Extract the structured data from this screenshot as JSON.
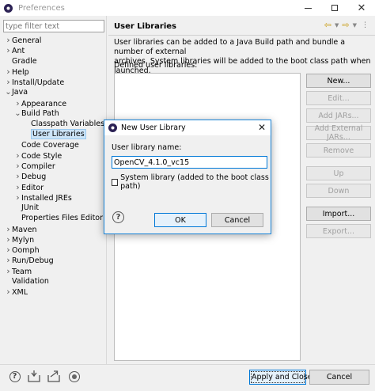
{
  "window": {
    "title": "Preferences",
    "icon": "eclipse-icon"
  },
  "filter": {
    "placeholder": "type filter text",
    "value": ""
  },
  "tree": [
    {
      "label": "General",
      "expander": "collapsed",
      "indent": 0
    },
    {
      "label": "Ant",
      "expander": "collapsed",
      "indent": 0
    },
    {
      "label": "Gradle",
      "expander": "none",
      "indent": 0
    },
    {
      "label": "Help",
      "expander": "collapsed",
      "indent": 0
    },
    {
      "label": "Install/Update",
      "expander": "collapsed",
      "indent": 0
    },
    {
      "label": "Java",
      "expander": "expanded",
      "indent": 0
    },
    {
      "label": "Appearance",
      "expander": "collapsed",
      "indent": 1
    },
    {
      "label": "Build Path",
      "expander": "expanded",
      "indent": 1
    },
    {
      "label": "Classpath Variables",
      "expander": "none",
      "indent": 2
    },
    {
      "label": "User Libraries",
      "expander": "none",
      "indent": 2,
      "selected": true
    },
    {
      "label": "Code Coverage",
      "expander": "none",
      "indent": 1
    },
    {
      "label": "Code Style",
      "expander": "collapsed",
      "indent": 1
    },
    {
      "label": "Compiler",
      "expander": "collapsed",
      "indent": 1
    },
    {
      "label": "Debug",
      "expander": "collapsed",
      "indent": 1
    },
    {
      "label": "Editor",
      "expander": "collapsed",
      "indent": 1
    },
    {
      "label": "Installed JREs",
      "expander": "collapsed",
      "indent": 1
    },
    {
      "label": "JUnit",
      "expander": "none",
      "indent": 1
    },
    {
      "label": "Properties Files Editor",
      "expander": "none",
      "indent": 1
    },
    {
      "label": "Maven",
      "expander": "collapsed",
      "indent": 0
    },
    {
      "label": "Mylyn",
      "expander": "collapsed",
      "indent": 0
    },
    {
      "label": "Oomph",
      "expander": "collapsed",
      "indent": 0
    },
    {
      "label": "Run/Debug",
      "expander": "collapsed",
      "indent": 0
    },
    {
      "label": "Team",
      "expander": "collapsed",
      "indent": 0
    },
    {
      "label": "Validation",
      "expander": "none",
      "indent": 0
    },
    {
      "label": "XML",
      "expander": "collapsed",
      "indent": 0
    }
  ],
  "page": {
    "title": "User Libraries",
    "description_line1": "User libraries can be added to a Java Build path and bundle a number of external",
    "description_line2": "archives. System libraries will be added to the boot class path when launched.",
    "list_label": "Defined user libraries:",
    "buttons": [
      {
        "label": "New...",
        "enabled": true
      },
      {
        "label": "Edit...",
        "enabled": false
      },
      {
        "label": "Add JARs...",
        "enabled": false
      },
      {
        "label": "Add External JARs...",
        "enabled": false
      },
      {
        "label": "Remove",
        "enabled": false
      },
      {
        "label": "Up",
        "enabled": false
      },
      {
        "label": "Down",
        "enabled": false
      },
      {
        "label": "Import...",
        "enabled": true
      },
      {
        "label": "Export...",
        "enabled": false
      }
    ]
  },
  "footer": {
    "apply_close_label": "Apply and Close",
    "cancel_label": "Cancel"
  },
  "dialog": {
    "title": "New User Library",
    "name_label": "User library name:",
    "name_value": "OpenCV_4.1.0_vc15",
    "system_library_label": "System library (added to the boot class path)",
    "system_library_checked": false,
    "ok_label": "OK",
    "cancel_label": "Cancel"
  },
  "colors": {
    "accent": "#0078d7",
    "selection": "#cce4f7",
    "nav_arrow": "#c89a10"
  }
}
